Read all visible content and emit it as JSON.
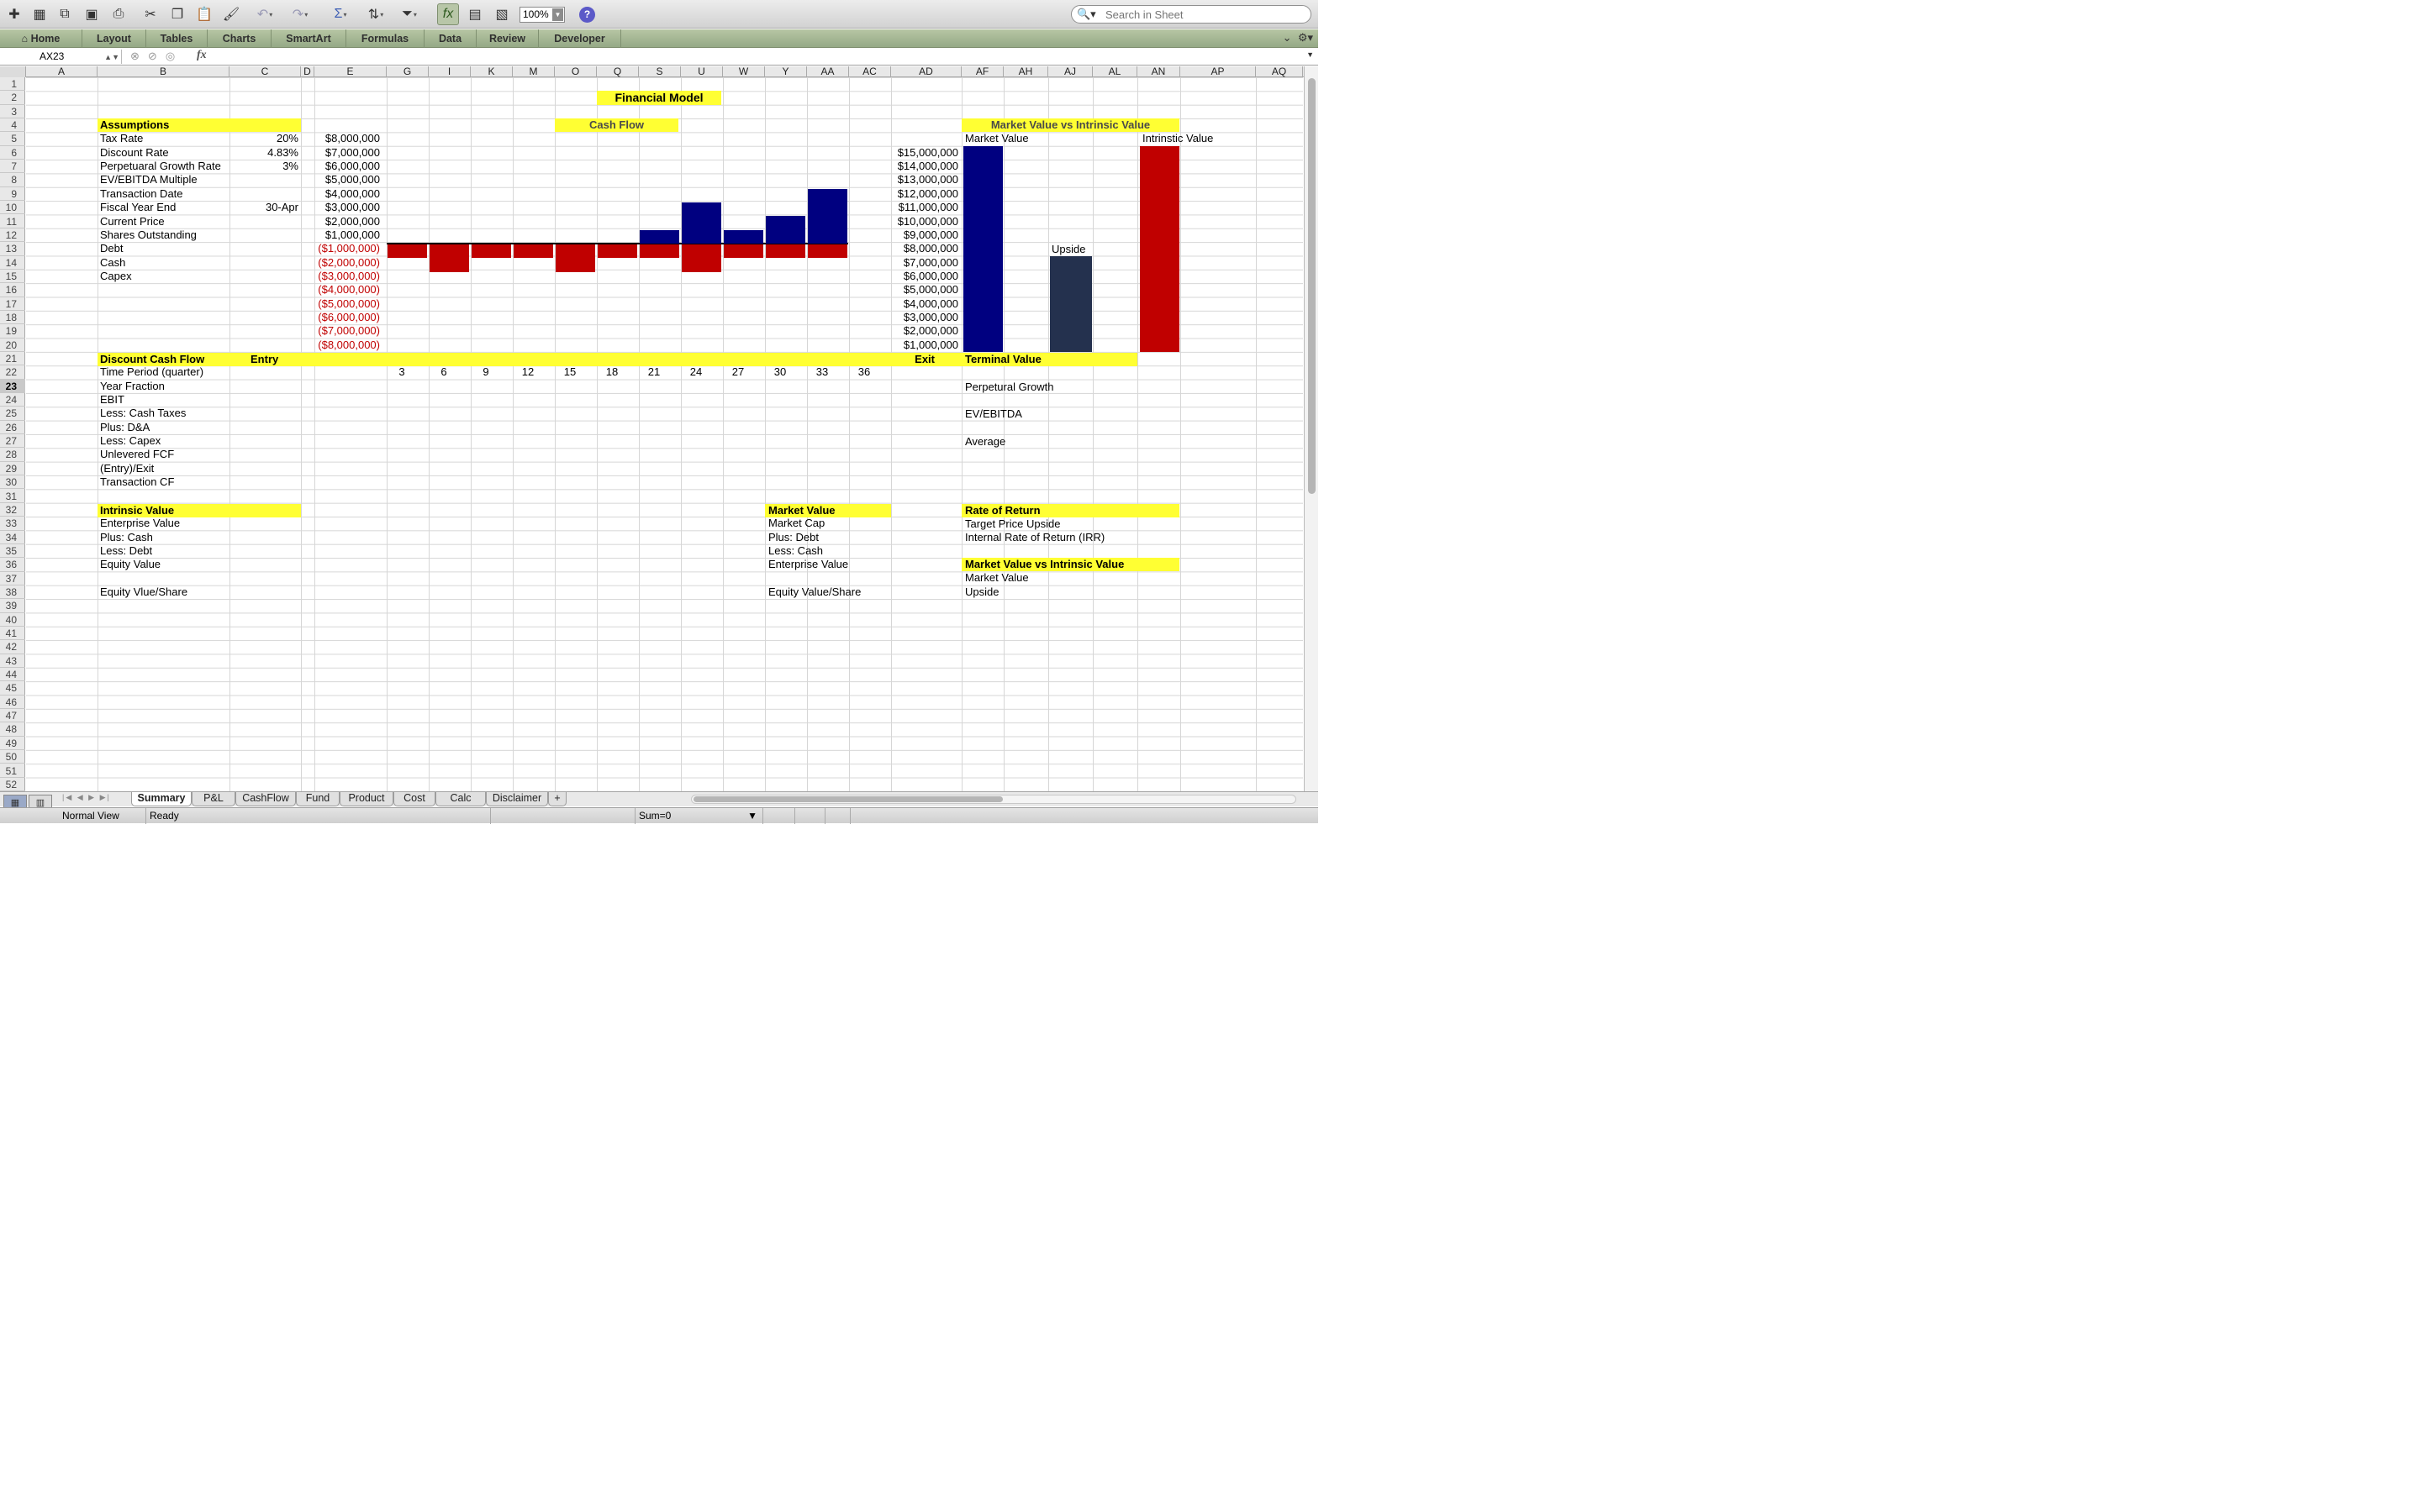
{
  "toolbar": {
    "zoom": "100%",
    "search_placeholder": "Search in Sheet",
    "icons": [
      "new-icon",
      "templates-icon",
      "open-icon",
      "save-icon",
      "print-icon",
      "cut-icon",
      "copy-icon",
      "paste-icon",
      "format-painter-icon",
      "undo-icon",
      "redo-icon",
      "autosum-icon",
      "sort-icon",
      "filter-icon",
      "formula-builder-icon",
      "toolbox-icon",
      "media-icon",
      "help-icon"
    ]
  },
  "ribbon": {
    "tabs": [
      "Home",
      "Layout",
      "Tables",
      "Charts",
      "SmartArt",
      "Formulas",
      "Data",
      "Review",
      "Developer"
    ]
  },
  "formula_bar": {
    "name_box": "AX23",
    "fx": "fx",
    "formula": ""
  },
  "columns": [
    "A",
    "B",
    "C",
    "D",
    "E",
    "G",
    "I",
    "K",
    "M",
    "O",
    "Q",
    "S",
    "U",
    "W",
    "Y",
    "AA",
    "AC",
    "AD",
    "AF",
    "AH",
    "AJ",
    "AL",
    "AN",
    "AP",
    "AQ"
  ],
  "rows": [
    "1",
    "2",
    "3",
    "4",
    "5",
    "6",
    "7",
    "8",
    "9",
    "10",
    "11",
    "12",
    "13",
    "14",
    "15",
    "16",
    "17",
    "18",
    "19",
    "20",
    "21",
    "22",
    "23",
    "24",
    "25",
    "26",
    "27",
    "28",
    "29",
    "30",
    "31",
    "32",
    "33",
    "34",
    "35",
    "36",
    "37",
    "38",
    "39",
    "40",
    "41",
    "42",
    "43",
    "44",
    "45",
    "46",
    "47",
    "48",
    "49",
    "50",
    "51",
    "52"
  ],
  "selected_row": "23",
  "sheet": {
    "title": "Financial Model",
    "cash_flow_header": "Cash Flow",
    "mvi_header": "Market Value vs Intrinsic Value",
    "mvi_market_value": "Market Value",
    "mvi_intrinsic_value": "Intrinstic Value",
    "upside_label": "Upside",
    "assumptions": {
      "header": "Assumptions",
      "items": [
        {
          "label": "Tax Rate",
          "value": "20%"
        },
        {
          "label": "Discount Rate",
          "value": "4.83%"
        },
        {
          "label": "Perpetuaral Growth Rate",
          "value": "3%"
        },
        {
          "label": "EV/EBITDA Multiple",
          "value": ""
        },
        {
          "label": "Transaction Date",
          "value": ""
        },
        {
          "label": "Fiscal Year End",
          "value": "30-Apr"
        },
        {
          "label": "Current Price",
          "value": ""
        },
        {
          "label": "Shares Outstanding",
          "value": ""
        },
        {
          "label": "Debt",
          "value": ""
        },
        {
          "label": "Cash",
          "value": ""
        },
        {
          "label": "Capex",
          "value": ""
        }
      ]
    },
    "dcf": {
      "header": "Discount Cash Flow",
      "entry": "Entry",
      "exit": "Exit",
      "rows": [
        "Time Period (quarter)",
        "Year Fraction",
        "EBIT",
        "Less: Cash Taxes",
        "Plus: D&A",
        "Less: Capex",
        "Unlevered FCF",
        "(Entry)/Exit",
        "Transaction CF"
      ],
      "periods": [
        "3",
        "6",
        "9",
        "12",
        "15",
        "18",
        "21",
        "24",
        "27",
        "30",
        "33",
        "36"
      ]
    },
    "terminal": {
      "header": "Terminal Value",
      "rows": [
        "Perpetural Growth",
        "EV/EBITDA",
        "Average"
      ]
    },
    "intrinsic": {
      "header": "Intrinsic Value",
      "rows": [
        "Enterprise Value",
        "Plus: Cash",
        "Less: Debt",
        "Equity Value",
        "",
        "Equity Vlue/Share"
      ]
    },
    "market": {
      "header": "Market Value",
      "rows": [
        "Market Cap",
        "Plus: Debt",
        "Less: Cash",
        "Enterprise Value",
        "",
        "Equity Value/Share"
      ]
    },
    "ror": {
      "header": "Rate of Return",
      "rows": [
        "Target Price Upside",
        "Internal Rate of Return (IRR)"
      ]
    },
    "mvi2": {
      "header": "Market Value vs Intrinsic Value",
      "rows": [
        "Market Value",
        "Upside"
      ]
    }
  },
  "chart_data": [
    {
      "type": "bar",
      "title": "Cash Flow",
      "axis_labels": [
        "$8,000,000",
        "$7,000,000",
        "$6,000,000",
        "$5,000,000",
        "$4,000,000",
        "$3,000,000",
        "$2,000,000",
        "$1,000,000",
        "($1,000,000)",
        "($2,000,000)",
        "($3,000,000)",
        "($4,000,000)",
        "($5,000,000)",
        "($6,000,000)",
        "($7,000,000)",
        "($8,000,000)"
      ],
      "ylim": [
        -8000000,
        8000000
      ],
      "series": [
        {
          "values": [
            0,
            0,
            0,
            0,
            0,
            0,
            1000000,
            3000000,
            1000000,
            2000000,
            4000000
          ],
          "color": "#000080"
        },
        {
          "values": [
            -1000000,
            -2000000,
            -1000000,
            -1000000,
            -2000000,
            -1000000,
            -1000000,
            -2000000,
            -1000000,
            -1000000,
            -1000000
          ],
          "color": "#c00000"
        }
      ]
    },
    {
      "type": "bar",
      "title": "Market Value vs Intrinsic Value",
      "axis_labels": [
        "$15,000,000",
        "$14,000,000",
        "$13,000,000",
        "$12,000,000",
        "$11,000,000",
        "$10,000,000",
        "$9,000,000",
        "$8,000,000",
        "$7,000,000",
        "$6,000,000",
        "$5,000,000",
        "$4,000,000",
        "$3,000,000",
        "$2,000,000",
        "$1,000,000"
      ],
      "categories": [
        "Market Value",
        "Upside",
        "Intrinstic Value"
      ],
      "values": [
        15000000,
        7000000,
        15000000
      ],
      "colors": [
        "#000080",
        "#24314e",
        "#c00000"
      ]
    }
  ],
  "sheet_tabs": [
    "Summary",
    "P&L",
    "CashFlow",
    "Fund",
    "Product",
    "Cost",
    "Calc",
    "Disclaimer",
    "+"
  ],
  "active_tab": "Summary",
  "status": {
    "view": "Normal View",
    "state": "Ready",
    "sum": "Sum=0"
  }
}
